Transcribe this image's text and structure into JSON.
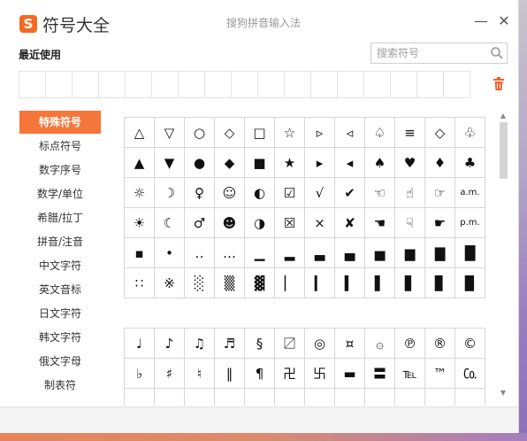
{
  "window": {
    "logo_text": "S",
    "title": "符号大全",
    "ime_name": "搜狗拼音输入法",
    "minimize_glyph": "—",
    "close_glyph": "✕"
  },
  "recent": {
    "label": "最近使用"
  },
  "search": {
    "placeholder": "搜索符号"
  },
  "sidebar": {
    "items": [
      {
        "label": "特殊符号"
      },
      {
        "label": "标点符号"
      },
      {
        "label": "数字序号"
      },
      {
        "label": "数学/单位"
      },
      {
        "label": "希腊/拉丁"
      },
      {
        "label": "拼音/注音"
      },
      {
        "label": "中文字符"
      },
      {
        "label": "英文音标"
      },
      {
        "label": "日文字符"
      },
      {
        "label": "韩文字符"
      },
      {
        "label": "俄文字母"
      },
      {
        "label": "制表符"
      }
    ]
  },
  "symbols_block1": [
    [
      "△",
      "▽",
      "○",
      "◇",
      "□",
      "☆",
      "▹",
      "◃",
      "♤",
      "≡",
      "◇",
      "♧"
    ],
    [
      "▲",
      "▼",
      "●",
      "◆",
      "■",
      "★",
      "▸",
      "◂",
      "♠",
      "♥",
      "♦",
      "♣"
    ],
    [
      "☼",
      "☽",
      "♀",
      "☺",
      "◐",
      "☑",
      "√",
      "✔",
      "☜",
      "☝",
      "☞",
      "a.m."
    ],
    [
      "☀",
      "☾",
      "♂",
      "☻",
      "◑",
      "☒",
      "×",
      "✘",
      "☚",
      "☟",
      "☛",
      "p.m."
    ],
    [
      "▪",
      "•",
      "‥",
      "…",
      "▁",
      "▂",
      "▃",
      "▄",
      "▅",
      "▆",
      "▇",
      "█"
    ],
    [
      "∷",
      "※",
      "░",
      "▒",
      "▓",
      "▏",
      "▎",
      "▍",
      "▌",
      "▋",
      "▊",
      "▉"
    ]
  ],
  "symbols_block2": [
    [
      "♩",
      "♪",
      "♫",
      "♬",
      "§",
      "〼",
      "◎",
      "¤",
      "۞",
      "℗",
      "®",
      "©"
    ],
    [
      "♭",
      "♯",
      "♮",
      "‖",
      "¶",
      "卍",
      "卐",
      "▬",
      "〓",
      "℡",
      "™",
      "㏇"
    ],
    [
      "",
      "",
      "",
      "",
      "",
      "",
      "",
      "",
      "",
      "",
      "",
      ""
    ]
  ],
  "accent_color": "#f5763a"
}
